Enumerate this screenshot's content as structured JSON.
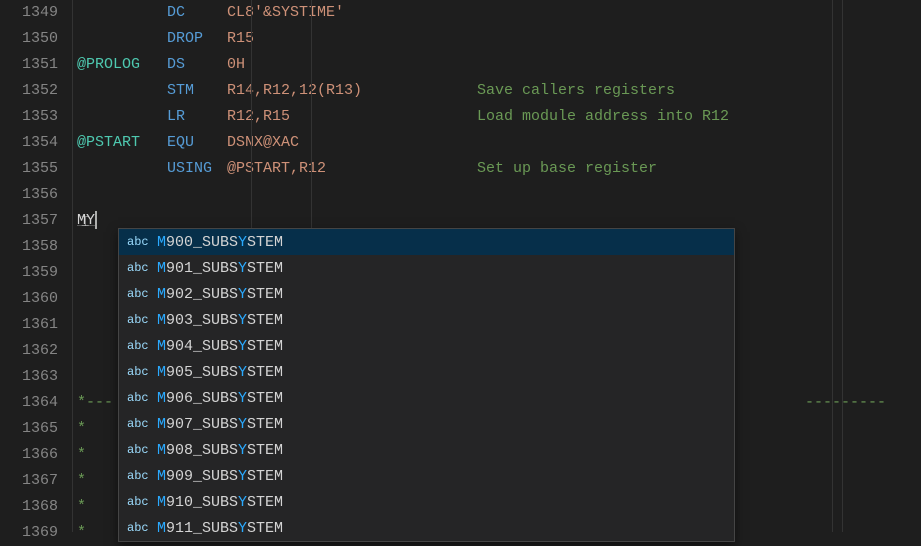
{
  "gutter_start": 1349,
  "gutter_end": 1369,
  "code_lines": [
    {
      "label": "",
      "op": "DC",
      "operand": "CL8'&SYSTIME'",
      "comment": ""
    },
    {
      "label": "",
      "op": "DROP",
      "operand": "R15",
      "comment": ""
    },
    {
      "label": "@PROLOG",
      "op": "DS",
      "operand": "0H",
      "comment": ""
    },
    {
      "label": "",
      "op": "STM",
      "operand": "R14,R12,12(R13)",
      "comment": "Save callers registers"
    },
    {
      "label": "",
      "op": "LR",
      "operand": "R12,R15",
      "comment": "Load module address into R12"
    },
    {
      "label": "@PSTART",
      "op": "EQU",
      "operand": "DSNX@XAC",
      "comment": ""
    },
    {
      "label": "",
      "op": "USING",
      "operand": "@PSTART,R12",
      "comment": "Set up base register"
    },
    {
      "raw": ""
    },
    {
      "cursor": true,
      "typed": "MY"
    },
    {
      "raw": ""
    },
    {
      "raw": ""
    },
    {
      "raw": ""
    },
    {
      "raw": ""
    },
    {
      "raw": ""
    },
    {
      "raw": ""
    },
    {
      "sep": true,
      "prefix": "*---"
    },
    {
      "raw": "*"
    },
    {
      "raw": "*"
    },
    {
      "raw": "*"
    },
    {
      "raw": "*"
    },
    {
      "raw": "*"
    }
  ],
  "suggestions": [
    {
      "icon": "abc",
      "pre": "M",
      "mid": "900_SUBS",
      "h2": "Y",
      "post": "STEM",
      "selected": true
    },
    {
      "icon": "abc",
      "pre": "M",
      "mid": "901_SUBS",
      "h2": "Y",
      "post": "STEM"
    },
    {
      "icon": "abc",
      "pre": "M",
      "mid": "902_SUBS",
      "h2": "Y",
      "post": "STEM"
    },
    {
      "icon": "abc",
      "pre": "M",
      "mid": "903_SUBS",
      "h2": "Y",
      "post": "STEM"
    },
    {
      "icon": "abc",
      "pre": "M",
      "mid": "904_SUBS",
      "h2": "Y",
      "post": "STEM"
    },
    {
      "icon": "abc",
      "pre": "M",
      "mid": "905_SUBS",
      "h2": "Y",
      "post": "STEM"
    },
    {
      "icon": "abc",
      "pre": "M",
      "mid": "906_SUBS",
      "h2": "Y",
      "post": "STEM"
    },
    {
      "icon": "abc",
      "pre": "M",
      "mid": "907_SUBS",
      "h2": "Y",
      "post": "STEM"
    },
    {
      "icon": "abc",
      "pre": "M",
      "mid": "908_SUBS",
      "h2": "Y",
      "post": "STEM"
    },
    {
      "icon": "abc",
      "pre": "M",
      "mid": "909_SUBS",
      "h2": "Y",
      "post": "STEM"
    },
    {
      "icon": "abc",
      "pre": "M",
      "mid": "910_SUBS",
      "h2": "Y",
      "post": "STEM"
    },
    {
      "icon": "abc",
      "pre": "M",
      "mid": "911_SUBS",
      "h2": "Y",
      "post": "STEM"
    }
  ],
  "sep_dashes": "------------------------------------------------------------------------"
}
